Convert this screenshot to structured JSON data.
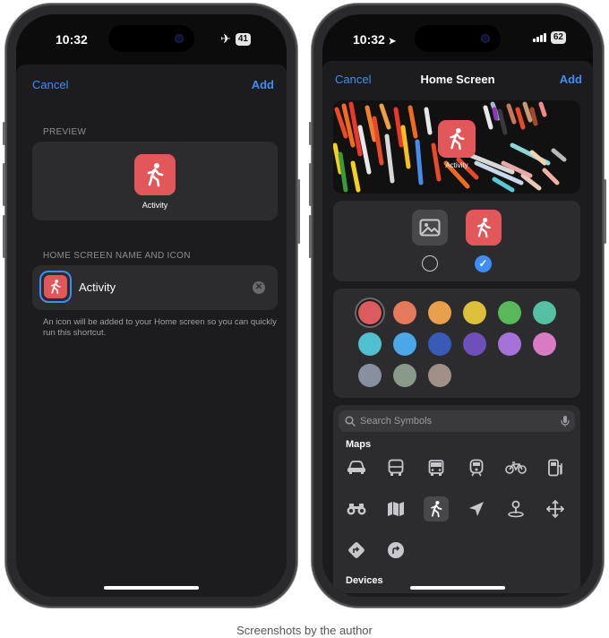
{
  "left": {
    "status": {
      "time": "10:32",
      "battery": "41"
    },
    "header": {
      "cancel": "Cancel",
      "add": "Add"
    },
    "preview": {
      "section_label": "PREVIEW",
      "app_name": "Activity"
    },
    "name_icon": {
      "section_label": "HOME SCREEN NAME AND ICON",
      "name_value": "Activity",
      "note": "An icon will be added to your Home screen so you can quickly run this shortcut."
    }
  },
  "right": {
    "status": {
      "time": "10:32",
      "battery": "62"
    },
    "header": {
      "cancel": "Cancel",
      "title": "Home Screen",
      "add": "Add"
    },
    "preview_app_name": "Activity",
    "colors": [
      "#dc5b5f",
      "#e47a5b",
      "#e8a04c",
      "#dcc039",
      "#58b85a",
      "#55c0a2",
      "#50c0cf",
      "#4aa8e8",
      "#3a5ab8",
      "#6e50b8",
      "#a472d8",
      "#d87ac4",
      "#8890a0",
      "#8a9a8a",
      "#a09088"
    ],
    "search": {
      "placeholder": "Search Symbols"
    },
    "symbols": {
      "category_maps": "Maps",
      "category_devices": "Devices",
      "icons": [
        "car-icon",
        "bus-icon",
        "tram-icon",
        "train-icon",
        "bicycle-icon",
        "fuel-pump-icon",
        "binoculars-icon",
        "map-icon",
        "walking-figure-icon",
        "location-arrow-icon",
        "pin-icon",
        "move-arrows-icon",
        "directions-sign-icon",
        "turn-arrow-icon"
      ]
    }
  },
  "caption": "Screenshots by the author",
  "accent_color": "#3d8ef7",
  "icon_color": "#e2585a"
}
